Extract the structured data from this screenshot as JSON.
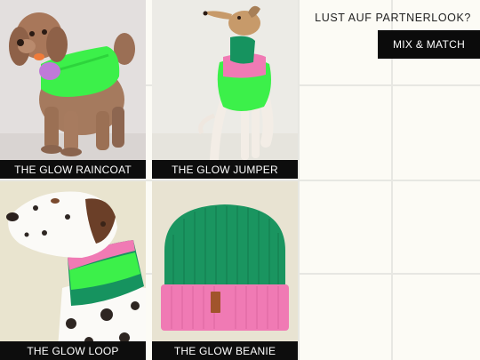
{
  "products": [
    {
      "name": "THE GLOW RAINCOAT"
    },
    {
      "name": "THE GLOW JUMPER"
    },
    {
      "name": "THE GLOW LOOP"
    },
    {
      "name": "THE GLOW BEANIE"
    }
  ],
  "promo": {
    "headline": "LUST AUF PARTNERLOOK?",
    "button_label": "MIX & MATCH"
  },
  "colors": {
    "background": "#fcfbf5",
    "caption_bg": "#0d0d0d",
    "neon_green": "#3cf04a",
    "forest_green": "#16935f",
    "pink": "#f07ab4"
  },
  "icons": {
    "raincoat_photo": "dog-raincoat-photo",
    "jumper_photo": "dog-jumper-photo",
    "loop_photo": "dog-loop-photo",
    "beanie_photo": "beanie-photo"
  }
}
